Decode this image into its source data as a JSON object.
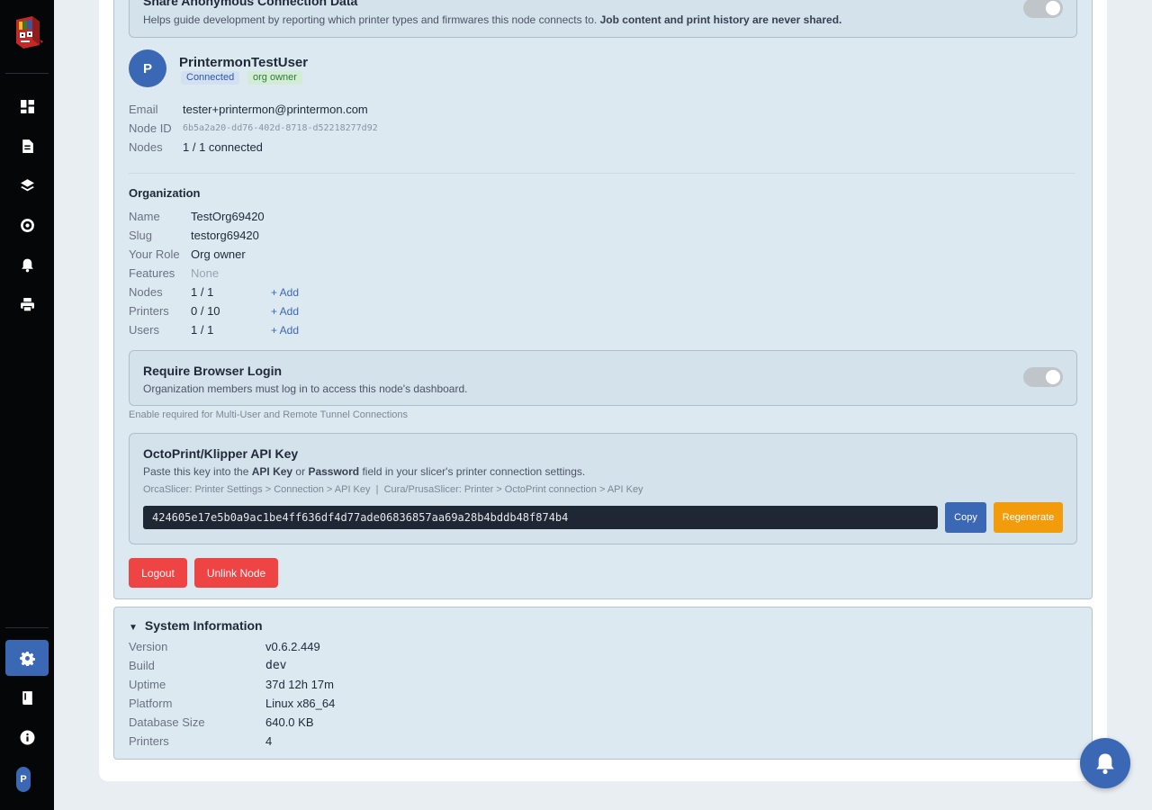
{
  "sidebar": {
    "avatar_letter": "P",
    "icons": [
      "dashboard-icon",
      "document-icon",
      "layers-icon",
      "target-icon",
      "bell-icon",
      "printer-icon",
      "gear-icon",
      "book-icon",
      "info-icon"
    ],
    "active": "gear-icon",
    "accent": "#3b68b5"
  },
  "anon_card": {
    "title": "Share Anonymous Connection Data",
    "desc": "Helps guide development by reporting which printer types and firmwares this node connects to.",
    "desc_bold": "Job content and print history are never shared.",
    "toggle_on": false
  },
  "user": {
    "avatar_letter": "P",
    "name": "PrintermonTestUser",
    "status_badge": "Connected",
    "role_badge": "org owner",
    "email_label": "Email",
    "email": "tester+printermon@printermon.com",
    "node_id_label": "Node ID",
    "node_id": "6b5a2a20-dd76-402d-8718-d52218277d92",
    "nodes_label": "Nodes",
    "nodes": "1 / 1 connected"
  },
  "organization": {
    "title": "Organization",
    "name_label": "Name",
    "name": "TestOrg69420",
    "slug_label": "Slug",
    "slug": "testorg69420",
    "role_label": "Your Role",
    "role": "Org owner",
    "features_label": "Features",
    "features": "None",
    "nodes_label": "Nodes",
    "nodes": "1 / 1",
    "printers_label": "Printers",
    "printers": "0 / 10",
    "users_label": "Users",
    "users": "1 / 1",
    "add_label": "+ Add"
  },
  "login_card": {
    "title": "Require Browser Login",
    "desc": "Organization members must log in to access this node's dashboard.",
    "toggle_on": false,
    "hint": "Enable required for Multi-User and Remote Tunnel Connections"
  },
  "api_card": {
    "title": "OctoPrint/Klipper API Key",
    "desc_pre": "Paste this key into the ",
    "desc_b1": "API Key",
    "desc_mid": " or ",
    "desc_b2": "Password",
    "desc_post": " field in your slicer's printer connection settings.",
    "hint": "OrcaSlicer: Printer Settings > Connection > API Key  |  Cura/PrusaSlicer: Printer > OctoPrint connection > API Key",
    "key": "424605e17e5b0a9ac1be4ff636df4d77ade06836857aa69a28b4bddb48f874b4",
    "copy_label": "Copy",
    "regenerate_label": "Regenerate"
  },
  "actions": {
    "logout_label": "Logout",
    "unlink_label": "Unlink Node"
  },
  "system": {
    "title": "System Information",
    "version_label": "Version",
    "version": "v0.6.2.449",
    "build_label": "Build",
    "build": "dev",
    "uptime_label": "Uptime",
    "uptime": "37d 12h 17m",
    "platform_label": "Platform",
    "platform": "Linux x86_64",
    "db_label": "Database Size",
    "db": "640.0 KB",
    "printers_label": "Printers",
    "printers": "4"
  }
}
